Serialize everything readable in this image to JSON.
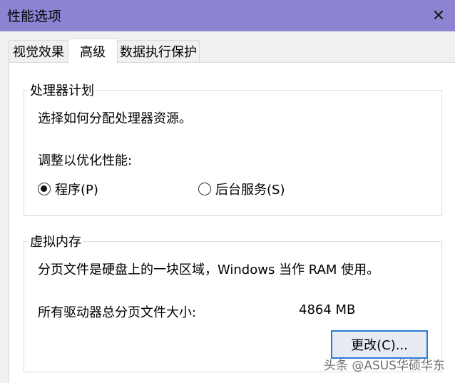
{
  "window": {
    "title": "性能选项",
    "close_glyph": "✕"
  },
  "tabs": [
    {
      "label": "视觉效果",
      "active": false
    },
    {
      "label": "高级",
      "active": true
    },
    {
      "label": "数据执行保护",
      "active": false
    }
  ],
  "processor": {
    "group_title": "处理器计划",
    "description": "选择如何分配处理器资源。",
    "adjust_label": "调整以优化性能:",
    "options": [
      {
        "label": "程序(P)",
        "checked": true
      },
      {
        "label": "后台服务(S)",
        "checked": false
      }
    ]
  },
  "virtual_memory": {
    "group_title": "虚拟内存",
    "description": "分页文件是硬盘上的一块区域，Windows 当作 RAM 使用。",
    "total_label": "所有驱动器总分页文件大小:",
    "total_value": "4864 MB",
    "change_button": "更改(C)..."
  },
  "watermark": "头条 @ASUS华硕华东"
}
